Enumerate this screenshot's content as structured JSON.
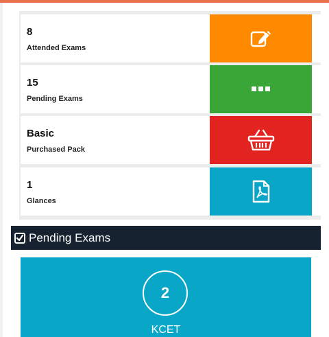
{
  "colors": {
    "orange": "#ff8a00",
    "green": "#3aa638",
    "red": "#e2231f",
    "teal": "#0aa6c8",
    "dark": "#172230"
  },
  "stats": [
    {
      "value": "8",
      "label": "Attended Exams",
      "icon": "edit-icon"
    },
    {
      "value": "15",
      "label": "Pending Exams",
      "icon": "ellipsis-icon"
    },
    {
      "value": "Basic",
      "label": "Purchased Pack",
      "icon": "basket-icon"
    },
    {
      "value": "1",
      "label": "Glances",
      "icon": "pdf-icon"
    }
  ],
  "pending_section": {
    "title": "Pending Exams",
    "icon": "check-square-icon",
    "exams": [
      {
        "count": "2",
        "name": "KCET"
      }
    ]
  }
}
